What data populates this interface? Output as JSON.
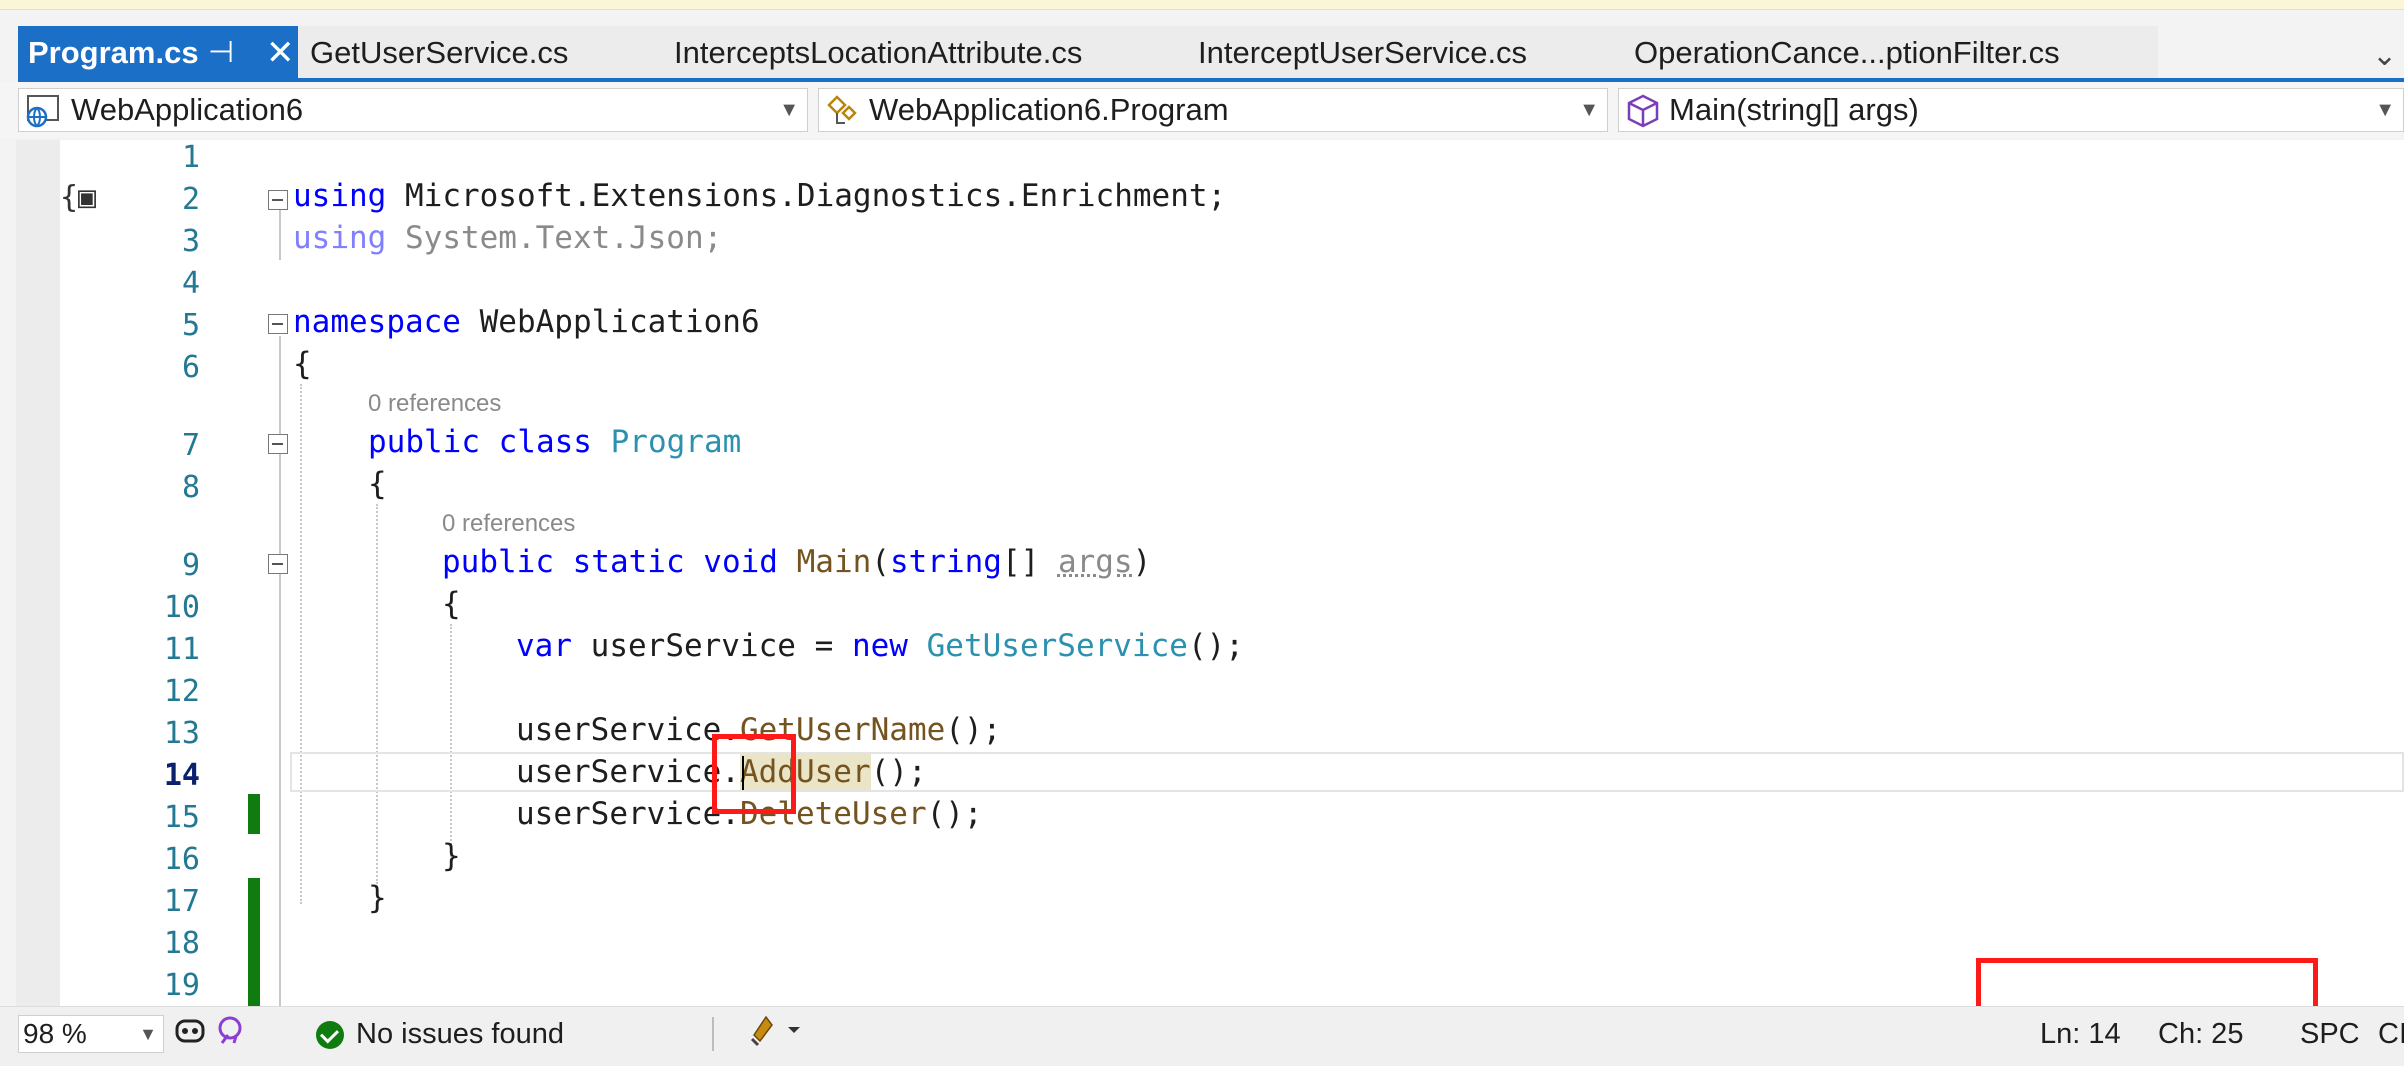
{
  "tabs": [
    {
      "label": "Program.cs",
      "active": true
    },
    {
      "label": "GetUserService.cs"
    },
    {
      "label": "InterceptsLocationAttribute.cs"
    },
    {
      "label": "InterceptUserService.cs"
    },
    {
      "label": "OperationCance...ptionFilter.cs"
    }
  ],
  "nav": {
    "project": "WebApplication6",
    "type": "WebApplication6.Program",
    "member": "Main(string[] args)"
  },
  "line_numbers": [
    "1",
    "2",
    "3",
    "4",
    "5",
    "6",
    "7",
    "8",
    "9",
    "10",
    "11",
    "12",
    "13",
    "14",
    "15",
    "16",
    "17",
    "18",
    "19"
  ],
  "code": {
    "l2_kw": "using",
    "l2_rest": " Microsoft.Extensions.Diagnostics.Enrichment;",
    "l3_kw": "using",
    "l3_rest": " System.Text.Json;",
    "l5_kw": "namespace",
    "l5_rest": " WebApplication6",
    "l6": "{",
    "refs_class": "0 references",
    "l7_kw": "public class",
    "l7_type": "Program",
    "l8": "{",
    "refs_main": "0 references",
    "l9_kw1": "public static void",
    "l9_meth": "Main",
    "l9_p1": "(",
    "l9_kw2": "string",
    "l9_p2": "[] ",
    "l9_param": "args",
    "l9_p3": ")",
    "l10": "{",
    "l11_kw": "var",
    "l11_mid": " userService = ",
    "l11_kw2": "new",
    "l11_type": "GetUserService",
    "l11_end": "();",
    "l13_obj": "userService.",
    "l13_meth": "GetUserName",
    "l13_end": "();",
    "l14_obj": "userService.",
    "l14_meth": "AddUser",
    "l14_end": "();",
    "l15_obj": "userService.",
    "l15_meth": "DeleteUser",
    "l15_end": "();",
    "l16": "}",
    "l17": "}"
  },
  "status": {
    "zoom": "98 %",
    "issues": "No issues found",
    "line": "Ln: 14",
    "col": "Ch: 25",
    "spacing": "SPC",
    "encoding_partial": "CI"
  },
  "colors": {
    "accent": "#1c6fc7",
    "keyword": "#0000ff",
    "type": "#2b91af",
    "method": "#74531f",
    "change_bar": "#107c10",
    "annotation": "#ff1a1a"
  }
}
